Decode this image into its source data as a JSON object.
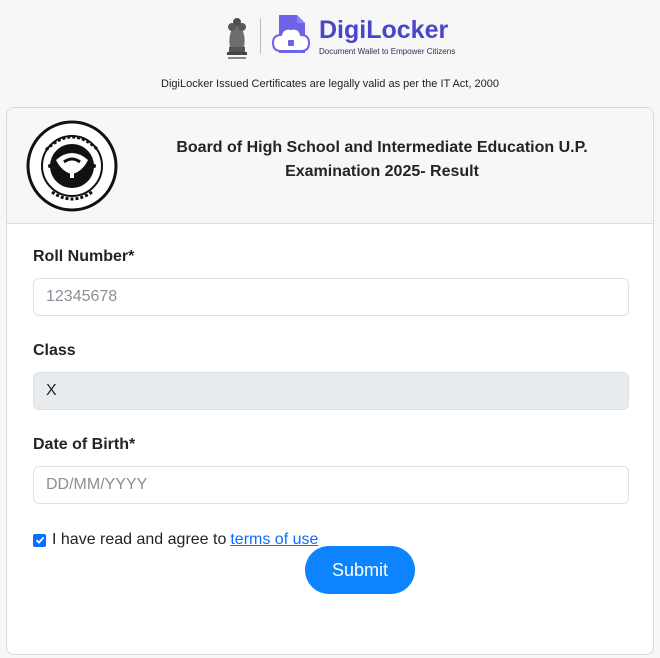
{
  "header": {
    "brand_name": "DigiLocker",
    "brand_tagline": "Document Wallet to Empower Citizens",
    "legal_note": "DigiLocker Issued Certificates are legally valid as per the IT Act, 2000"
  },
  "card": {
    "title_line1": "Board of High School and Intermediate Education U.P.",
    "title_line2": "Examination 2025- Result"
  },
  "form": {
    "roll_number": {
      "label": "Roll Number*",
      "placeholder": "12345678",
      "value": ""
    },
    "class": {
      "label": "Class",
      "value": "X"
    },
    "dob": {
      "label": "Date of Birth*",
      "placeholder": "DD/MM/YYYY",
      "value": ""
    },
    "agree": {
      "text": "I have read and agree to",
      "link": "terms of use",
      "checked": true
    },
    "submit_label": "Submit"
  },
  "colors": {
    "brand": "#4b45c9",
    "primary": "#0d6efd",
    "submit": "#0d84fd"
  }
}
